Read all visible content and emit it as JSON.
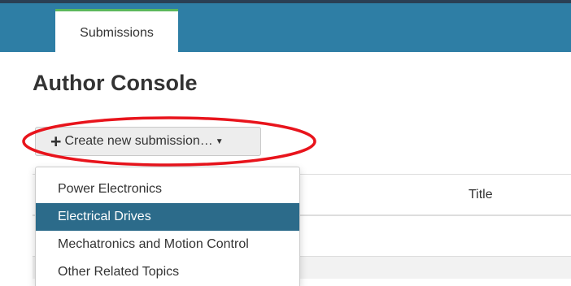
{
  "nav": {
    "tabs": [
      {
        "label": "Submissions",
        "active": true
      }
    ],
    "colors": {
      "bar": "#2e7ea5",
      "active_tab_accent": "#5cb85c"
    }
  },
  "page": {
    "title": "Author Console"
  },
  "create_button": {
    "icon": "plus-icon",
    "label": "Create new submission…",
    "caret_icon": "caret-down-icon"
  },
  "dropdown_menu": {
    "items": [
      {
        "label": "Power Electronics",
        "selected": false
      },
      {
        "label": "Electrical Drives",
        "selected": true
      },
      {
        "label": "Mechatronics and Motion Control",
        "selected": false
      },
      {
        "label": "Other Related Topics",
        "selected": false
      }
    ],
    "highlight_color": "#2c6b8a"
  },
  "table": {
    "columns": [
      "Title"
    ]
  },
  "annotation": {
    "shape": "ellipse",
    "color": "#e8141c"
  }
}
